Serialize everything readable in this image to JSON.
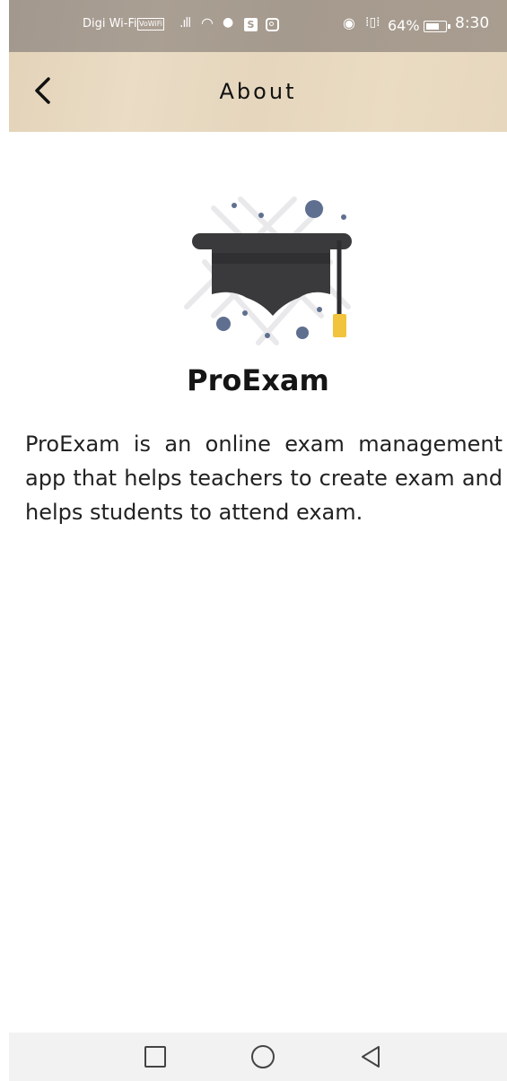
{
  "status_bar": {
    "carrier": "Digi Wi-Fi",
    "vowifi_badge": "VoWiFi",
    "s_badge": "S",
    "battery_percent": "64%",
    "time": "8:30",
    "icons": [
      "signal-icon",
      "wifi-icon",
      "wechat-icon",
      "s-app-icon",
      "instagram-icon",
      "eye-icon",
      "vibrate-icon",
      "battery-icon"
    ]
  },
  "app_bar": {
    "title": "About",
    "back_icon": "back-arrow-icon"
  },
  "content": {
    "logo_icon": "graduation-cap-icon",
    "app_name": "ProExam",
    "description": "ProExam is an online exam management app that helps teachers to create exam and helps students to attend exam."
  },
  "nav_bar": {
    "icons": [
      "recent-apps-icon",
      "home-icon",
      "back-icon"
    ]
  },
  "colors": {
    "status_bar": "#a59a8e",
    "app_bar": "#e6d7be",
    "cap": "#3a3a3c",
    "tassel": "#f2c43d",
    "dots": "#5f6f8f"
  }
}
